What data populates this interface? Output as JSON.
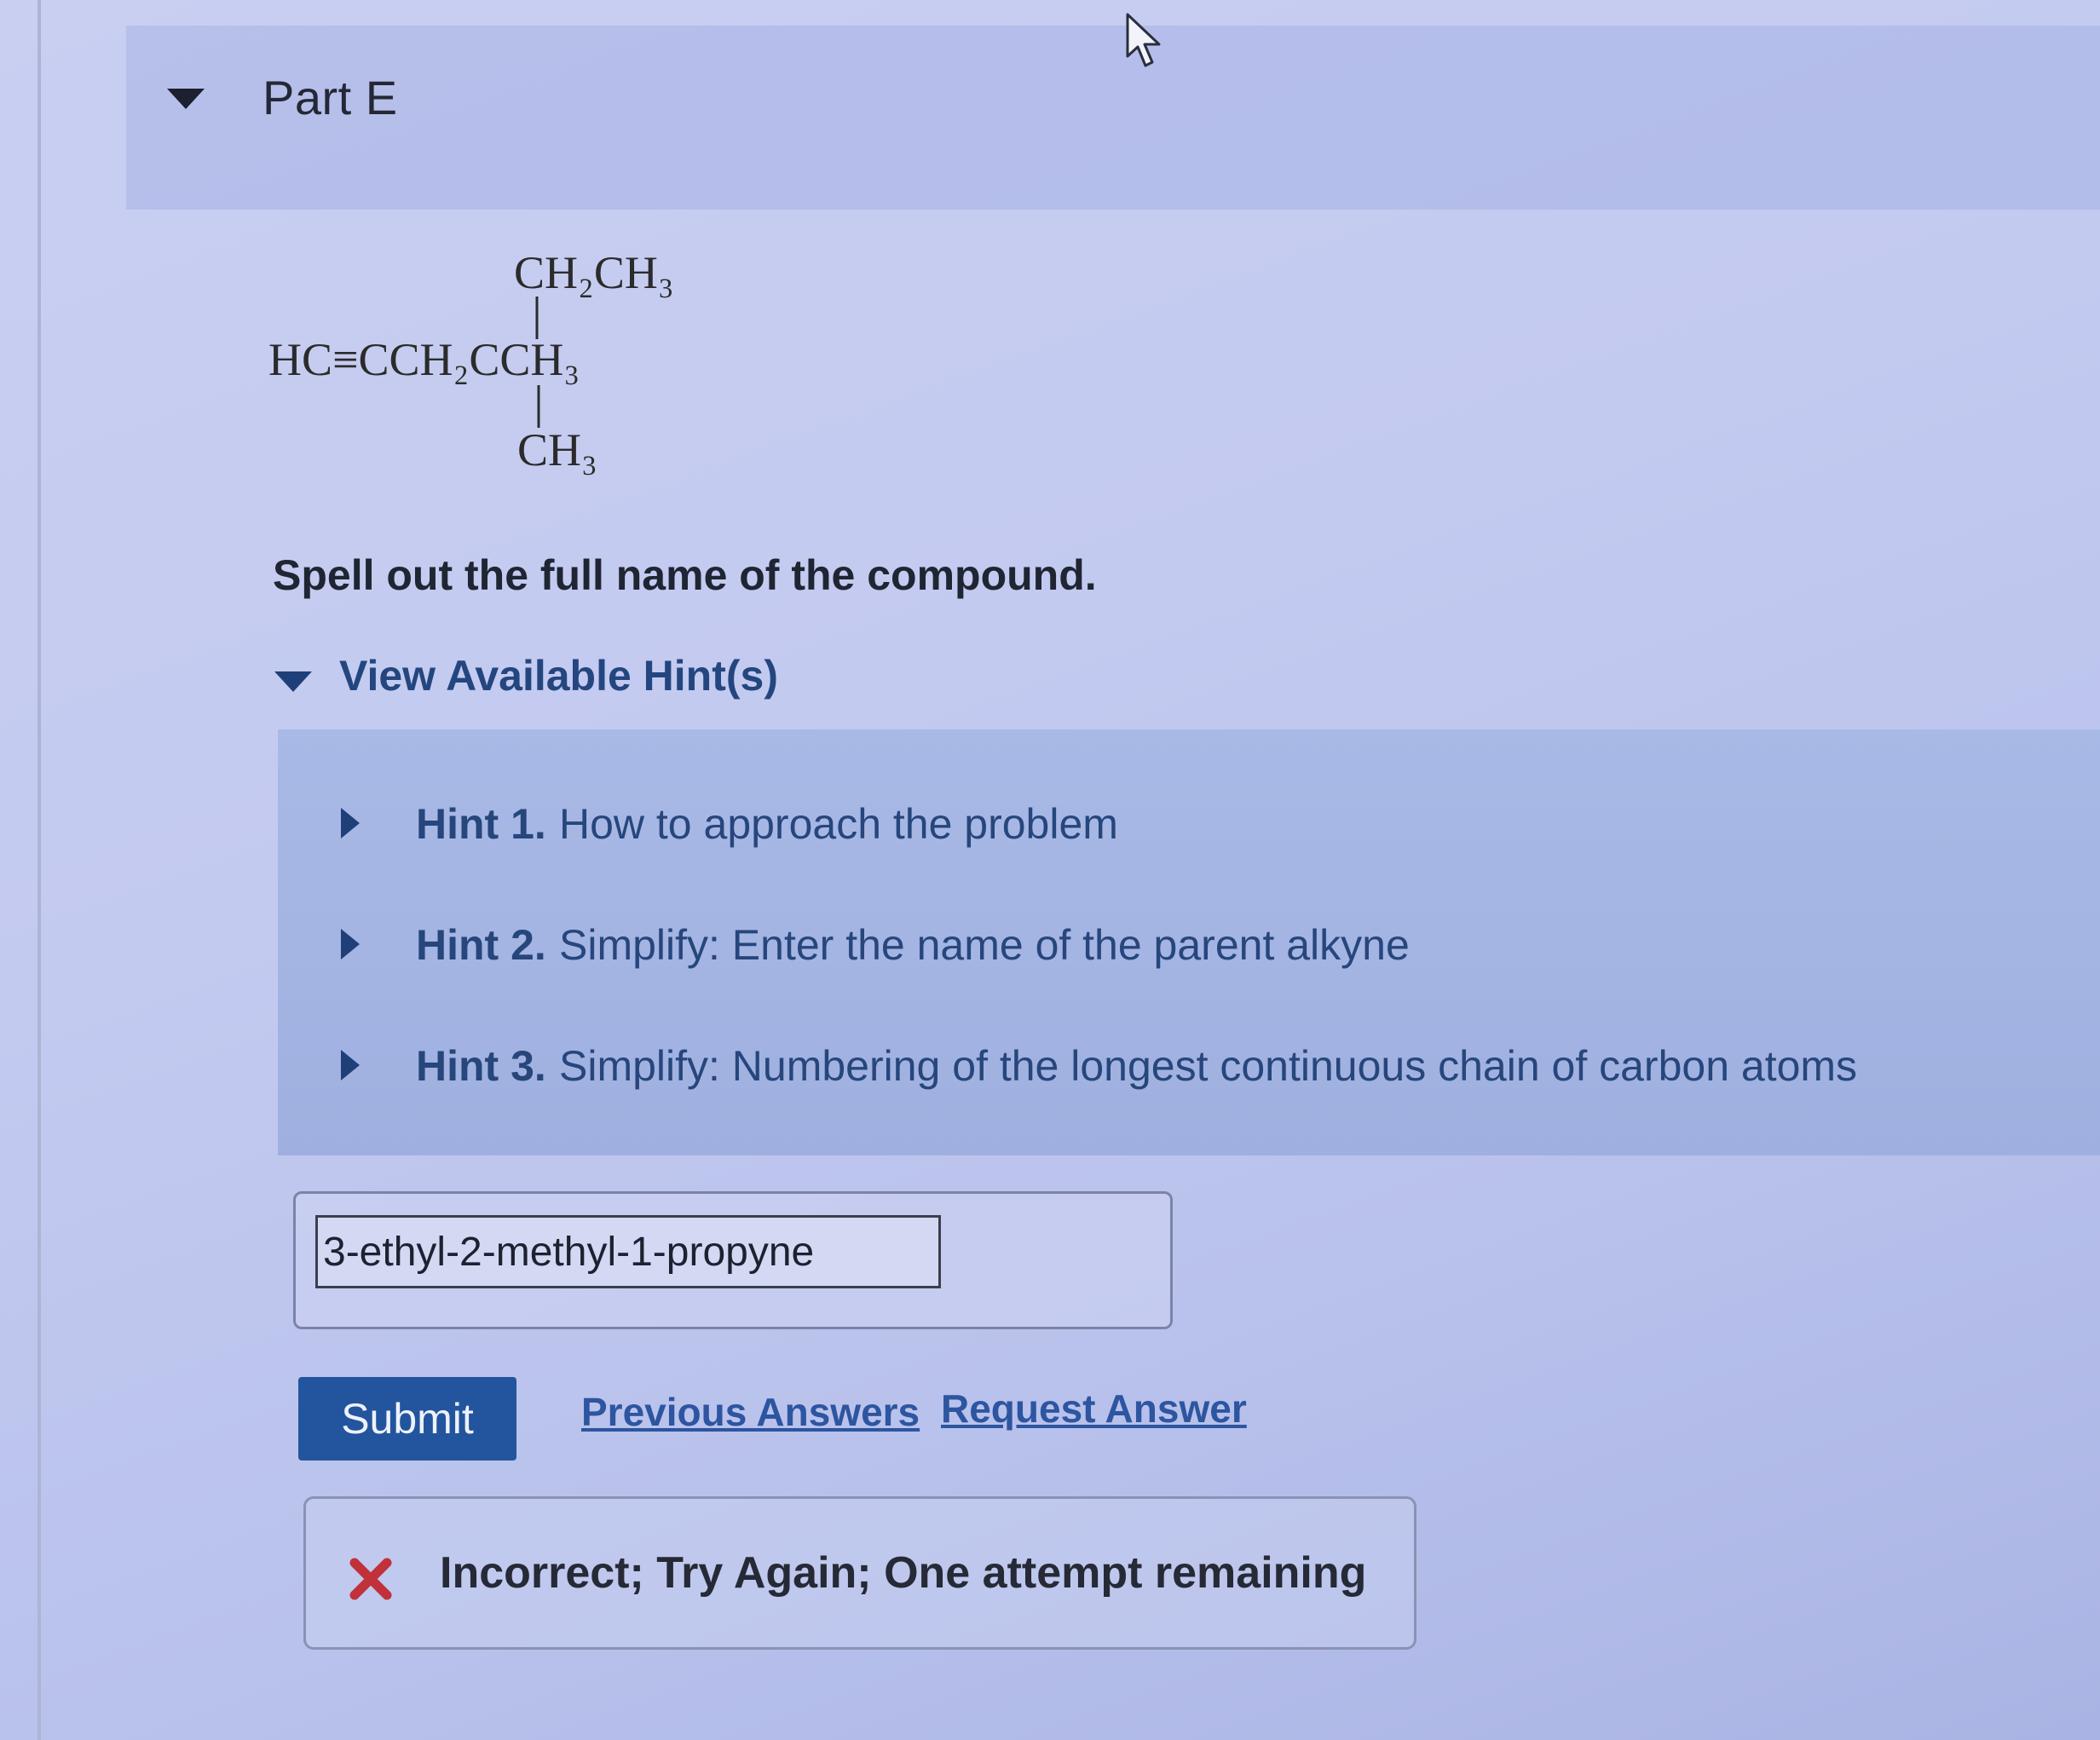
{
  "part": {
    "title": "Part E"
  },
  "structure": {
    "main_chain": "HC≡CCH₂CCH₃",
    "top_substituent": "CH₂CH₃",
    "bottom_substituent": "CH₃"
  },
  "question": {
    "prompt": "Spell out the full name of the compound."
  },
  "hints": {
    "toggle_label": "View Available Hint(s)",
    "items": [
      {
        "number": "Hint 1.",
        "text": "How to approach the problem"
      },
      {
        "number": "Hint 2.",
        "text": "Simplify: Enter the name of the parent alkyne"
      },
      {
        "number": "Hint 3.",
        "text": "Simplify: Numbering of the longest continuous chain of carbon atoms"
      }
    ]
  },
  "answer": {
    "value": "3-ethyl-2-methyl-1-propyne"
  },
  "actions": {
    "submit_label": "Submit",
    "previous_answers_label": "Previous Answers",
    "request_answer_label": "Request Answer"
  },
  "feedback": {
    "message": "Incorrect; Try Again; One attempt remaining",
    "status_color": "#c0313a"
  },
  "icons": {
    "part_toggle": "caret-down-icon",
    "hint_toggle": "caret-down-icon",
    "hint_expand": "caret-right-icon",
    "feedback_status": "x-mark-icon",
    "cursor": "mouse-pointer-icon"
  }
}
